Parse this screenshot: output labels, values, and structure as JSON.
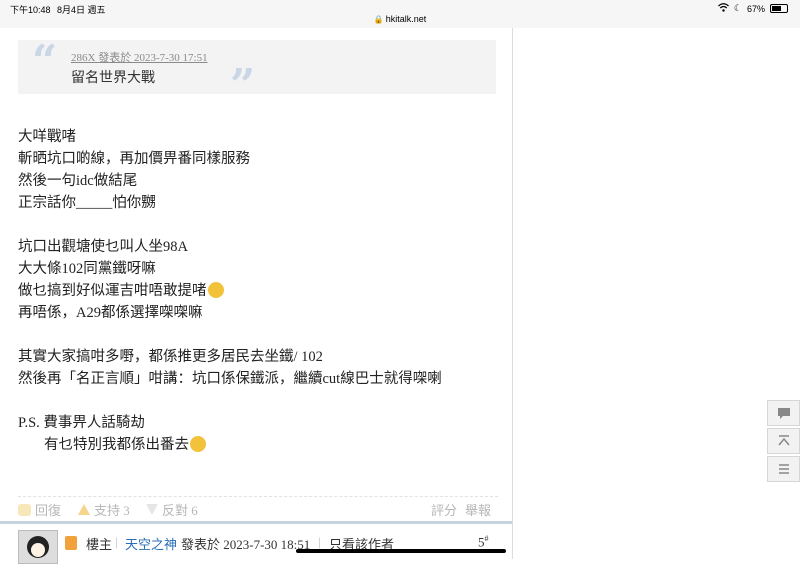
{
  "status_bar": {
    "time": "下午10:48",
    "date": "8月4日 週五",
    "url": "hkitalk.net",
    "battery": "67%",
    "battery_level": 0.67
  },
  "quote": {
    "meta": "286X 發表於 2023-7-30 17:51",
    "text": "留名世界大戰"
  },
  "post_lines": [
    "大咩戰啫",
    "斬晒坑口啲線，再加價畀番同樣服務",
    "然後一句idc做結尾",
    "正宗話你_____怕你嬲",
    "",
    "坑口出觀塘使乜叫人坐98A",
    "大大條102同黨鐵呀嘛",
    "做乜搞到好似運吉咁唔敢提啫",
    "再唔係，A29都係選擇㗎㗎嘛",
    "",
    "其實大家搞咁多嘢，都係推更多居民去坐鐵/ 102",
    "然後再「名正言順」咁講：坑口係保鐵派，繼續cut線巴士就得㗎喇",
    "",
    "P.S. 費事畀人話騎劫",
    "有乜特別我都係出番去"
  ],
  "actions": {
    "reply": "回復",
    "support": "支持 3",
    "oppose": "反對 6",
    "rate": "評分",
    "report": "舉報"
  },
  "footer": {
    "owner_label": "樓主",
    "separator": "|",
    "author": "天空之神",
    "posted": "發表於 2023-7-30 18:51",
    "only_author": "只看該作者",
    "floor": "5",
    "floor_sup": "#"
  },
  "icons": [
    "lock-icon",
    "wifi-icon",
    "moon-icon",
    "battery-icon",
    "reply-icon",
    "thumb-up-icon",
    "thumb-down-icon",
    "owner-icon",
    "comment-icon",
    "scroll-top-icon",
    "list-icon"
  ],
  "colors": {
    "accent": "#2a6db8",
    "quote_mark": "#c8d6e6",
    "footer_border": "#c7d3df"
  }
}
